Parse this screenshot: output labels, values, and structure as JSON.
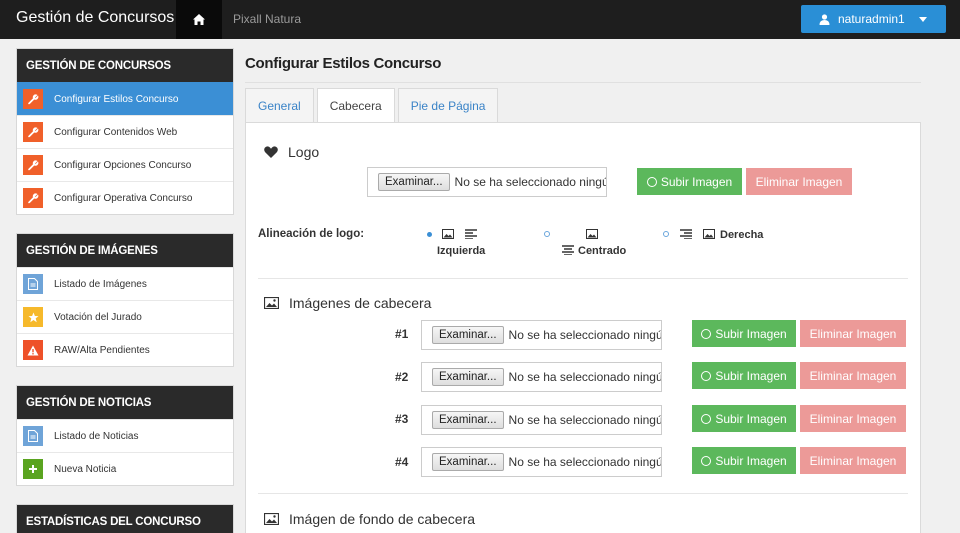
{
  "navbar": {
    "brand": "Gestión de Concursos",
    "link": "Pixall Natura",
    "user": "naturadmin1"
  },
  "sidebar": {
    "panels": [
      {
        "title": "GESTIÓN DE CONCURSOS",
        "items": [
          {
            "label": "Configurar Estilos Concurso",
            "icon": "wrench-icon",
            "color": "#f0602a",
            "active": true
          },
          {
            "label": "Configurar Contenidos Web",
            "icon": "wrench-icon",
            "color": "#f0602a"
          },
          {
            "label": "Configurar Opciones Concurso",
            "icon": "wrench-icon",
            "color": "#f0602a"
          },
          {
            "label": "Configurar Operativa Concurso",
            "icon": "wrench-icon",
            "color": "#f0602a"
          }
        ]
      },
      {
        "title": "GESTIÓN DE IMÁGENES",
        "items": [
          {
            "label": "Listado de Imágenes",
            "icon": "document-icon",
            "color": "#6fa4d8"
          },
          {
            "label": "Votación del Jurado",
            "icon": "star-icon",
            "color": "#f6b92b"
          },
          {
            "label": "RAW/Alta Pendientes",
            "icon": "warning-icon",
            "color": "#ee5129"
          }
        ]
      },
      {
        "title": "GESTIÓN DE NOTICIAS",
        "items": [
          {
            "label": "Listado de Noticias",
            "icon": "document-icon",
            "color": "#6fa4d8"
          },
          {
            "label": "Nueva Noticia",
            "icon": "plus-icon",
            "color": "#5aa420"
          }
        ]
      },
      {
        "title": "ESTADÍSTICAS DEL CONCURSO",
        "items": []
      }
    ]
  },
  "main": {
    "title": "Configurar Estilos Concurso",
    "tabs": [
      {
        "label": "General",
        "active": false
      },
      {
        "label": "Cabecera",
        "active": true
      },
      {
        "label": "Pie de Página",
        "active": false
      }
    ],
    "logo": {
      "title": "Logo",
      "browse": "Examinar...",
      "no_file": "No se ha seleccionado ningún archivo.",
      "upload": "Subir Imagen",
      "delete": "Eliminar Imagen"
    },
    "alignment": {
      "label": "Alineación de logo:",
      "options": [
        "Izquierda",
        "Centrado",
        "Derecha"
      ],
      "selected": "Izquierda"
    },
    "header_images": {
      "title": "Imágenes de cabecera",
      "rows": [
        {
          "num": "#1",
          "browse": "Examinar...",
          "no_file": "No se ha seleccionado ningún archivo.",
          "upload": "Subir Imagen",
          "delete": "Eliminar Imagen"
        },
        {
          "num": "#2",
          "browse": "Examinar...",
          "no_file": "No se ha seleccionado ningún archivo.",
          "upload": "Subir Imagen",
          "delete": "Eliminar Imagen"
        },
        {
          "num": "#3",
          "browse": "Examinar...",
          "no_file": "No se ha seleccionado ningún archivo.",
          "upload": "Subir Imagen",
          "delete": "Eliminar Imagen"
        },
        {
          "num": "#4",
          "browse": "Examinar...",
          "no_file": "No se ha seleccionado ningún archivo.",
          "upload": "Subir Imagen",
          "delete": "Eliminar Imagen"
        }
      ]
    },
    "bg_image": {
      "title": "Imágen de fondo de cabecera"
    }
  },
  "colors": {
    "accent": "#3b8fd5",
    "success": "#5cb85c",
    "danger_light": "#ec9a98",
    "navbar": "#1e1e1e"
  }
}
